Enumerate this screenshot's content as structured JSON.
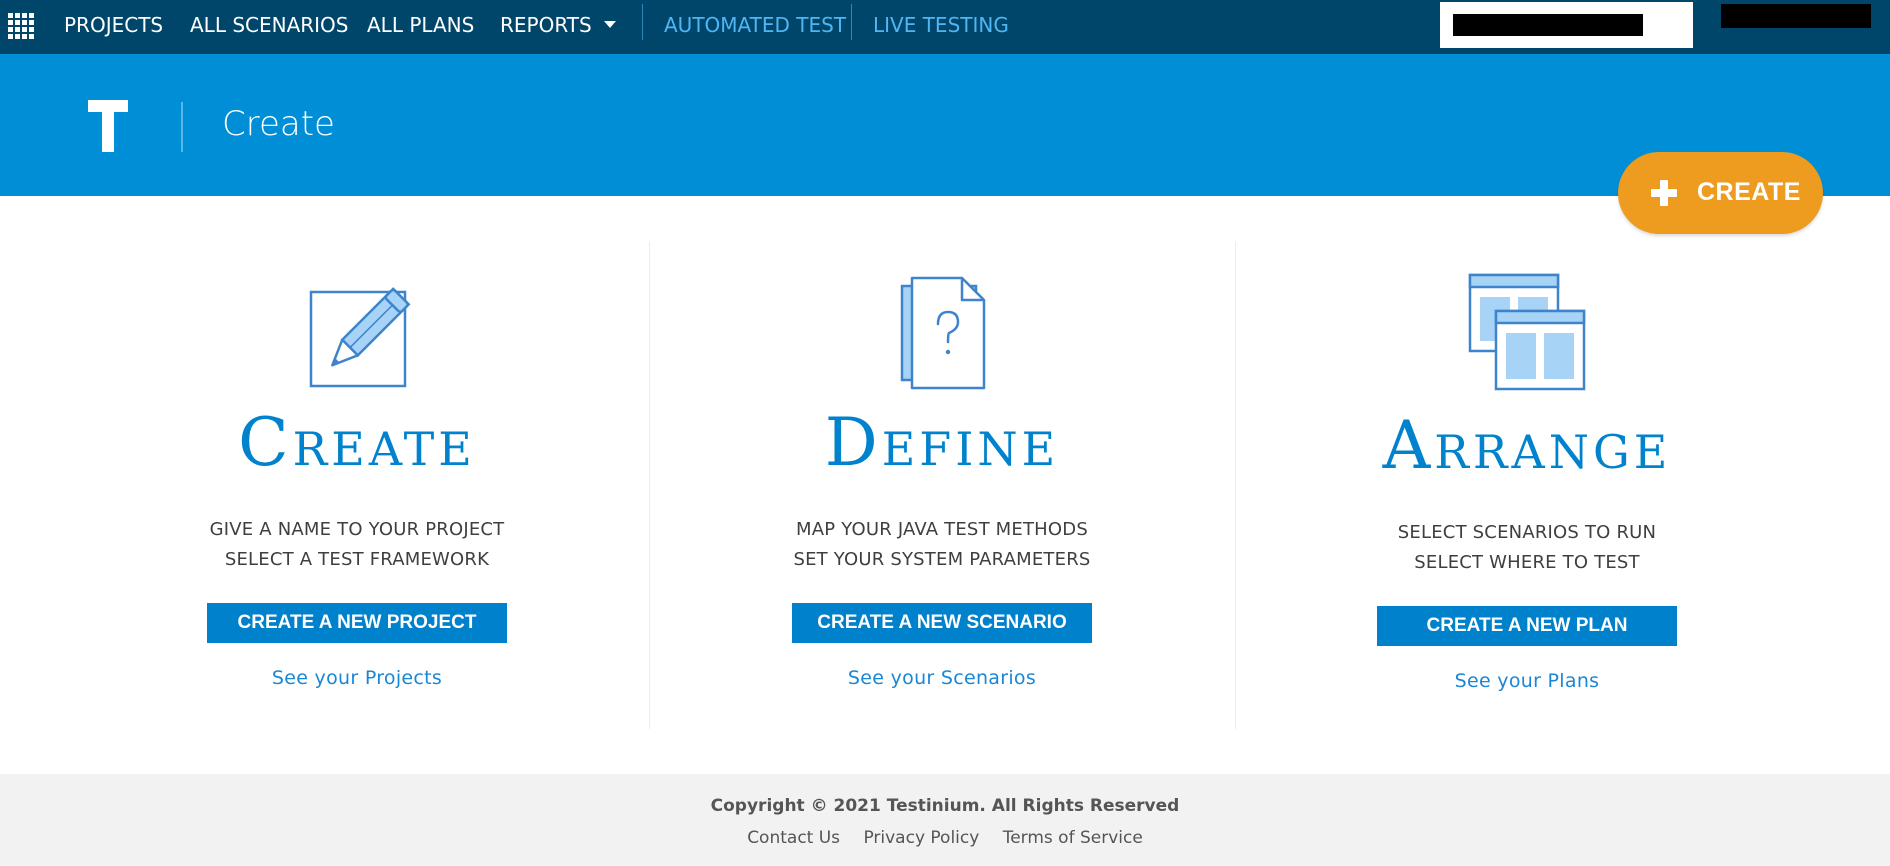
{
  "nav": {
    "items": [
      "PROJECTS",
      "ALL SCENARIOS",
      "ALL PLANS",
      "REPORTS"
    ],
    "automated_test": "AUTOMATED TEST",
    "live_testing": "LIVE TESTING"
  },
  "hero": {
    "logo_letter": "T",
    "title": "Create"
  },
  "fab": {
    "label": "CREATE"
  },
  "columns": [
    {
      "icon": "edit-pencil-icon",
      "heading": "Create",
      "line1": "GIVE A NAME TO YOUR PROJECT",
      "line2": "SELECT A TEST FRAMEWORK",
      "button": "CREATE A NEW PROJECT",
      "link": "See your Projects"
    },
    {
      "icon": "document-question-icon",
      "heading": "Define",
      "line1": "MAP YOUR JAVA TEST METHODS",
      "line2": "SET YOUR SYSTEM PARAMETERS",
      "button": "CREATE A NEW SCENARIO",
      "link": "See your Scenarios"
    },
    {
      "icon": "layout-windows-icon",
      "heading": "Arrange",
      "line1": "SELECT SCENARIOS TO RUN",
      "line2": "SELECT WHERE TO TEST",
      "button": "CREATE A NEW PLAN",
      "link": "See your Plans"
    }
  ],
  "footer": {
    "copyright": "Copyright © 2021 Testinium. All Rights Reserved",
    "links": [
      "Contact Us",
      "Privacy Policy",
      "Terms of Service"
    ]
  },
  "colors": {
    "nav_bg": "#00466b",
    "hero_bg": "#008fd7",
    "accent": "#0081cc",
    "fab": "#ed9c1f",
    "footer_bg": "#f2f2f2"
  }
}
